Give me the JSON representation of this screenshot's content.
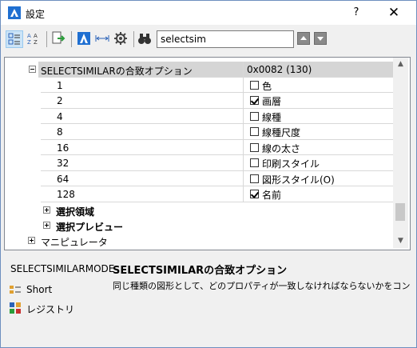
{
  "window": {
    "title": "設定",
    "help_label": "?",
    "close_label": "✕"
  },
  "toolbar": {
    "search_value": "selectsim",
    "icons": [
      "categorized-view-icon",
      "alphabetical-view-icon",
      "export-icon",
      "drawing-settings-icon",
      "dimension-settings-icon",
      "settings-gear-icon",
      "find-binoculars-icon",
      "previous-match-icon",
      "next-match-icon"
    ]
  },
  "tree": {
    "header": {
      "label": "SELECTSIMILARの合致オプション",
      "value": "0x0082 (130)"
    },
    "options": [
      {
        "code": "1",
        "label": "色",
        "checked": false
      },
      {
        "code": "2",
        "label": "画層",
        "checked": true
      },
      {
        "code": "4",
        "label": "線種",
        "checked": false
      },
      {
        "code": "8",
        "label": "線種尺度",
        "checked": false
      },
      {
        "code": "16",
        "label": "線の太さ",
        "checked": false
      },
      {
        "code": "32",
        "label": "印刷スタイル",
        "checked": false
      },
      {
        "code": "64",
        "label": "図形スタイル(O)",
        "checked": false
      },
      {
        "code": "128",
        "label": "名前",
        "checked": true
      }
    ],
    "groups": [
      "選択領域",
      "選択プレビュー"
    ],
    "root_group": "マニピュレータ"
  },
  "description": {
    "variable_name": "SELECTSIMILARMODE",
    "title": "SELECTSIMILARの合致オプション",
    "text": "同じ種類の図形として、どのプロパティが一致しなければならないかをコントロ・",
    "items": [
      {
        "label": "Short",
        "icon": "short-type-icon"
      },
      {
        "label": "レジストリ",
        "icon": "registry-icon"
      }
    ]
  },
  "colors": {
    "accent": "#1f6fd1",
    "header_row": "#d5d5d5",
    "active_button": "#cce4f7"
  }
}
